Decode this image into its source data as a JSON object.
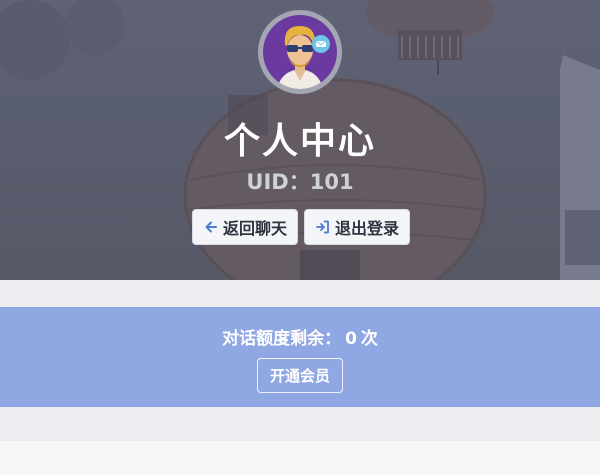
{
  "profile": {
    "title": "个人中心",
    "uid_text": "UID：101",
    "avatar_icon": "user-avatar-icon"
  },
  "actions": {
    "back_label": "返回聊天",
    "back_icon": "arrow-left-icon",
    "logout_label": "退出登录",
    "logout_icon": "sign-in-icon"
  },
  "quota": {
    "label": "对话额度剩余：",
    "value": "0",
    "unit": "次",
    "member_button": "开通会员"
  },
  "colors": {
    "quota_band": "#8fa7e2",
    "avatar_bg": "#6b3aa0",
    "button_icon": "#4d7bd4"
  }
}
